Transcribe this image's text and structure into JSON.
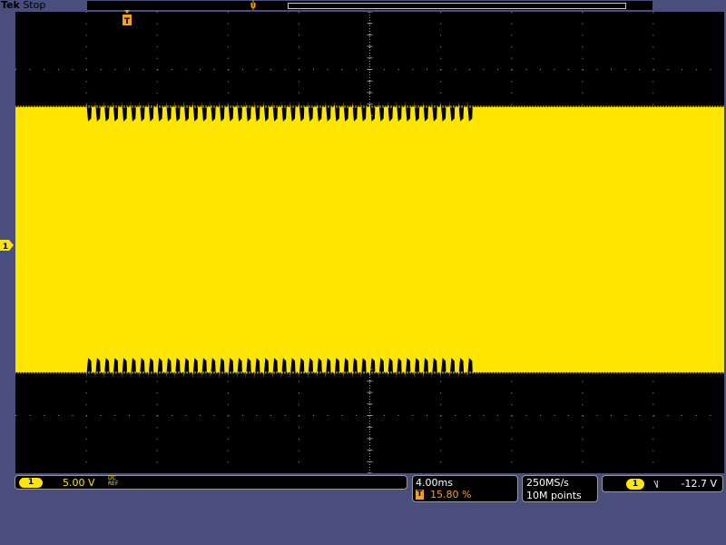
{
  "status": {
    "brand": "Tek",
    "state": "Stop"
  },
  "colors": {
    "channel1": "#ffe600",
    "trigger": "#f7a11a",
    "screen": "#000000",
    "frame": "#4a4e7c",
    "grid": "#9a9a9a"
  },
  "markers": {
    "channel": "1",
    "trigger_t": "T",
    "position_u": "U"
  },
  "channel": {
    "badge": "1",
    "volts_div": "5.00 V",
    "coupling": "DC",
    "coupling_sub": "REF"
  },
  "timebase": {
    "scale": "4.00ms",
    "trigger_position": "15.80 %",
    "t_icon": "T"
  },
  "acquisition": {
    "sample_rate": "250MS/s",
    "record_length": "10M points"
  },
  "trigger": {
    "source_badge": "1",
    "slope": "˥˩",
    "level": "-12.7 V"
  },
  "waveform": {
    "bursts": 44,
    "envelope_top_div": 2.35,
    "envelope_bottom_div": -2.25,
    "burst_dip_div": 0.25,
    "burst_span_div": [
      1.0,
      6.5
    ]
  }
}
